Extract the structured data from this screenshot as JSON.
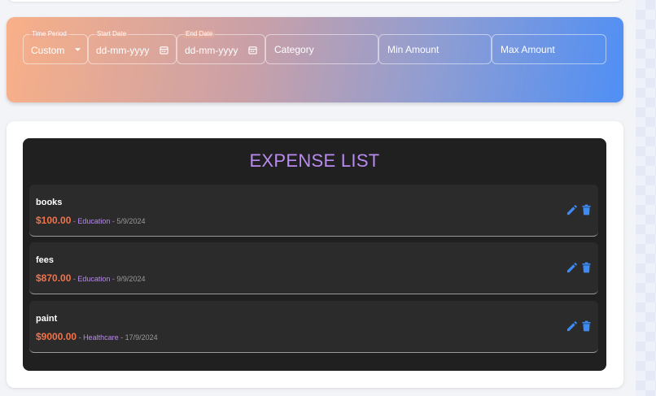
{
  "filters": {
    "time_period": {
      "label": "Time Period",
      "value": "Custom"
    },
    "start_date": {
      "label": "Start Date",
      "value": "dd-mm-yyyy"
    },
    "end_date": {
      "label": "End Date",
      "value": "dd-mm-yyyy"
    },
    "category": {
      "placeholder": "Category"
    },
    "min_amount": {
      "placeholder": "Min Amount"
    },
    "max_amount": {
      "placeholder": "Max Amount"
    }
  },
  "expense_list": {
    "title": "EXPENSE LIST",
    "separator": " - ",
    "items": [
      {
        "name": "books",
        "amount": "$100.00",
        "category": "Education",
        "date": "5/9/2024"
      },
      {
        "name": "fees",
        "amount": "$870.00",
        "category": "Education",
        "date": "9/9/2024"
      },
      {
        "name": "paint",
        "amount": "$9000.00",
        "category": "Healthcare",
        "date": "17/9/2024"
      }
    ]
  },
  "colors": {
    "accent_purple": "#b98af0",
    "amount_orange": "#f0734a",
    "icon_blue": "#3d8bf5",
    "panel_dark": "#202020",
    "item_dark": "#2b2b2b"
  },
  "icons": {
    "edit": "pencil-icon",
    "delete": "trash-icon",
    "calendar": "calendar-icon",
    "dropdown": "chevron-down-icon"
  }
}
